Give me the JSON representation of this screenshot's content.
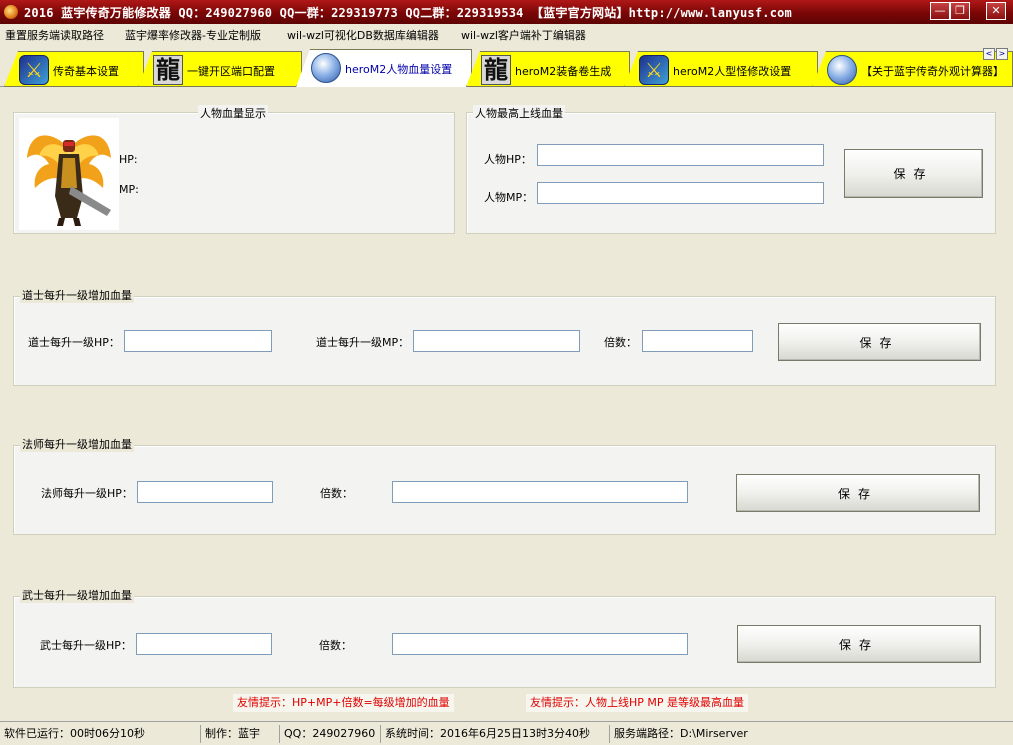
{
  "window": {
    "title": "2016 蓝宇传奇万能修改器  QQ：249027960 QQ一群：229319773 QQ二群：229319534  【蓝宇官方网站】http://www.lanyusf.com",
    "minimize_glyph": "—",
    "restore_glyph": "❐",
    "close_glyph": "✕"
  },
  "menu": [
    "重置服务端读取路径",
    "蓝宇爆率修改器-专业定制版",
    "wil-wzl可视化DB数据库编辑器",
    "wil-wzl客户端补丁编辑器"
  ],
  "tabs": [
    {
      "label": "传奇基本设置",
      "icon": "sword-emblem-icon"
    },
    {
      "label": "一键开区端口配置",
      "icon": "dragon-glyph-icon"
    },
    {
      "label": "heroM2人物血量设置",
      "icon": "globe-icon",
      "active": true
    },
    {
      "label": "heroM2装备卷生成",
      "icon": "dragon-glyph-icon"
    },
    {
      "label": "heroM2人型怪修改设置",
      "icon": "sword-emblem-icon"
    },
    {
      "label": "【关于蓝宇传奇外观计算器】",
      "icon": "globe-icon"
    }
  ],
  "tab_scroll": {
    "left": "<",
    "right": ">"
  },
  "icons": {
    "dragon_glyph": "龍",
    "sword_glyph": "⚔"
  },
  "hp_display": {
    "title": "人物血量显示",
    "hp_label": "HP:",
    "mp_label": "MP:"
  },
  "max_online": {
    "title": "人物最高上线血量",
    "hp_label": "人物HP：",
    "hp_value": "",
    "mp_label": "人物MP：",
    "mp_value": "",
    "save": "保存"
  },
  "taoist": {
    "title": "道士每升一级增加血量",
    "hp_label": "道士每升一级HP：",
    "hp_value": "",
    "mp_label": "道士每升一级MP：",
    "mp_value": "",
    "mult_label": "倍数：",
    "mult_value": "",
    "save": "保存"
  },
  "mage": {
    "title": "法师每升一级增加血量",
    "hp_label": "法师每升一级HP：",
    "hp_value": "",
    "mult_label": "倍数：",
    "mult_value": "",
    "save": "保存"
  },
  "warrior": {
    "title": "武士每升一级增加血量",
    "hp_label": "武士每升一级HP：",
    "hp_value": "",
    "mult_label": "倍数：",
    "mult_value": "",
    "save": "保存"
  },
  "hints": [
    "友情提示：HP+MP+倍数=每级增加的血量",
    "友情提示：人物上线HP MP 是等级最高血量"
  ],
  "status": {
    "runtime": "软件已运行：00时06分10秒",
    "author": "制作：蓝宇",
    "qq": "QQ：249027960",
    "system_time": "系统时间：2016年6月25日13时3分40秒",
    "server_path": "服务端路径：D:\\Mirserver"
  },
  "colors": {
    "titlebar": "#8a0c0c",
    "tab": "#ffff00",
    "hint": "#e00000"
  }
}
